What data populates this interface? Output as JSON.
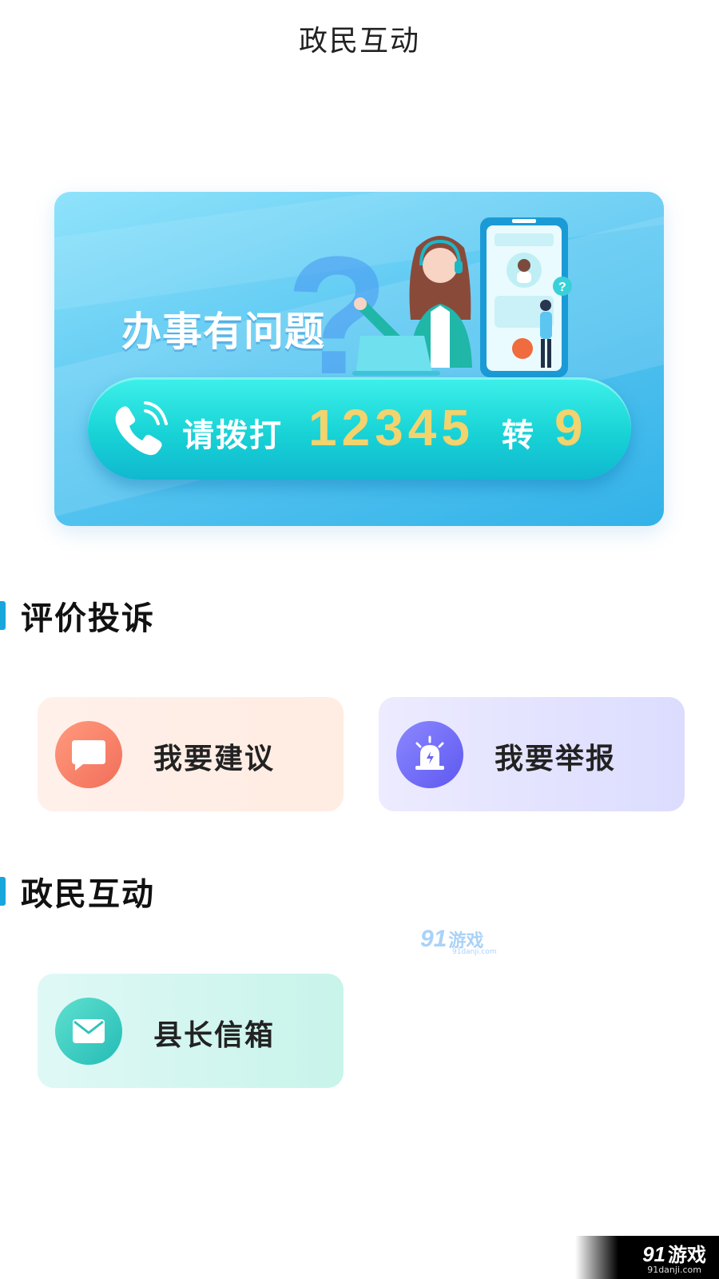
{
  "header": {
    "title": "政民互动"
  },
  "banner": {
    "headline": "办事有问题",
    "call": {
      "prefix": "请拨打",
      "number": "12345",
      "transfer": "转",
      "extension": "9"
    },
    "phone_icon": "phone-ringing-icon",
    "question_icon": "question-mark-icon"
  },
  "sections": {
    "evaluation": {
      "title": "评价投诉",
      "cards": [
        {
          "label": "我要建议",
          "icon": "speech-bubble-icon",
          "accent": "#f26e5a"
        },
        {
          "label": "我要举报",
          "icon": "alarm-light-icon",
          "accent": "#5f58f0"
        }
      ]
    },
    "interaction": {
      "title": "政民互动",
      "cards": [
        {
          "label": "县长信箱",
          "icon": "envelope-icon",
          "accent": "#24bcb6"
        }
      ]
    }
  },
  "watermark": {
    "number": "91",
    "text": "游戏",
    "domain": "91danji.com"
  },
  "corner_badge": {
    "number": "91",
    "text": "游戏",
    "domain": "91danji.com"
  },
  "colors": {
    "section_bar": "#19a6dc",
    "number_gold": "#f2d36d",
    "banner_cyan": "#18d3d6"
  }
}
